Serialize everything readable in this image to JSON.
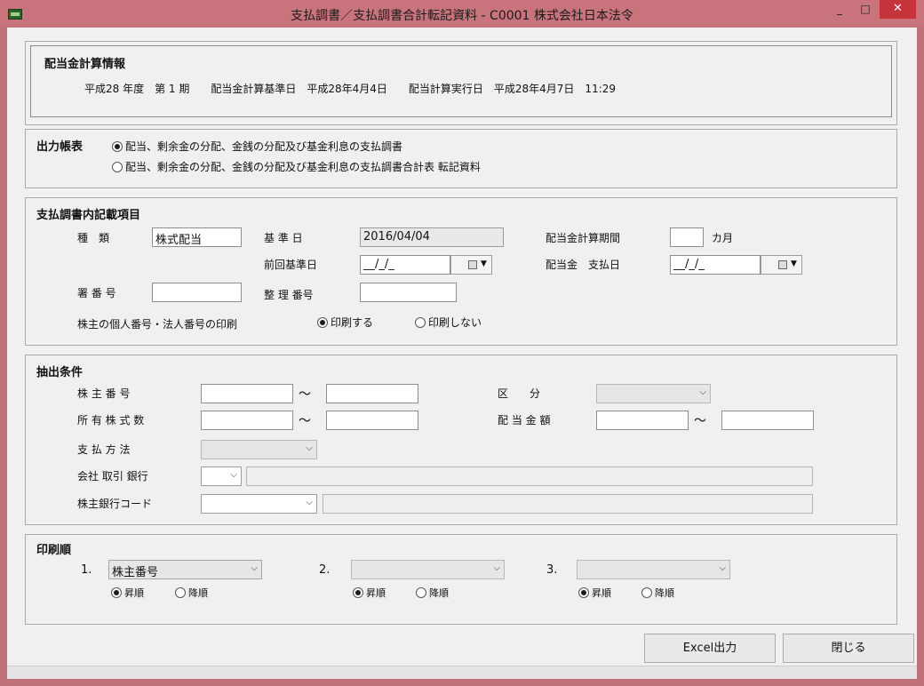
{
  "window": {
    "title": "支払調書／支払調書合計転記資料 - C0001 株式会社日本法令",
    "min_glyph": "_",
    "max_glyph": "□",
    "close_glyph": "✕"
  },
  "info": {
    "title": "配当金計算情報",
    "line": "平成28 年度　第 1 期　　配当金計算基準日　平成28年4月4日　　配当計算実行日　平成28年4月7日　11:29"
  },
  "output": {
    "title": "出力帳表",
    "options": [
      {
        "label": "配当、剰余金の分配、金銭の分配及び基金利息の支払調書",
        "selected": true
      },
      {
        "label": "配当、剰余金の分配、金銭の分配及び基金利息の支払調書合計表 転記資料",
        "selected": false
      }
    ]
  },
  "items": {
    "title": "支払調書内記載項目",
    "kind_label": "種　類",
    "kind_value": "株式配当",
    "base_date_label": "基 準 日",
    "base_date_value": "2016/04/04",
    "period_label": "配当金計算期間",
    "period_value": "",
    "period_unit": "カ月",
    "prev_base_label": "前回基準日",
    "prev_base_value": "__/_/_",
    "pay_date_label": "配当金　支払日",
    "pay_date_value": "__/_/_",
    "office_label": "署 番 号",
    "office_value": "",
    "ref_label": "整 理 番号",
    "ref_value": "",
    "print_label": "株主の個人番号・法人番号の印刷",
    "print_yes": "印刷する",
    "print_no": "印刷しない",
    "print_selected": "yes"
  },
  "filter": {
    "title": "抽出条件",
    "shareholder_no_label": "株 主 番 号",
    "shares_label": "所 有 株 式 数",
    "payment_label": "支 払 方 法",
    "bank_label": "会社 取引 銀行",
    "sh_bank_label": "株主銀行コード",
    "division_label": "区　　分",
    "amount_label": "配 当 金 額",
    "tilde": "～",
    "shareholder_from": "",
    "shareholder_to": "",
    "shares_from": "",
    "shares_to": "",
    "amount_from": "",
    "amount_to": "",
    "bank_name": "",
    "sh_bank_name": ""
  },
  "order": {
    "title": "印刷順",
    "slots": [
      {
        "num": "1.",
        "value": "株主番号",
        "asc": "昇順",
        "desc": "降順",
        "selected": "asc"
      },
      {
        "num": "2.",
        "value": "",
        "asc": "昇順",
        "desc": "降順",
        "selected": "asc"
      },
      {
        "num": "3.",
        "value": "",
        "asc": "昇順",
        "desc": "降順",
        "selected": "asc"
      }
    ]
  },
  "buttons": {
    "excel": "Excel出力",
    "close": "閉じる"
  }
}
